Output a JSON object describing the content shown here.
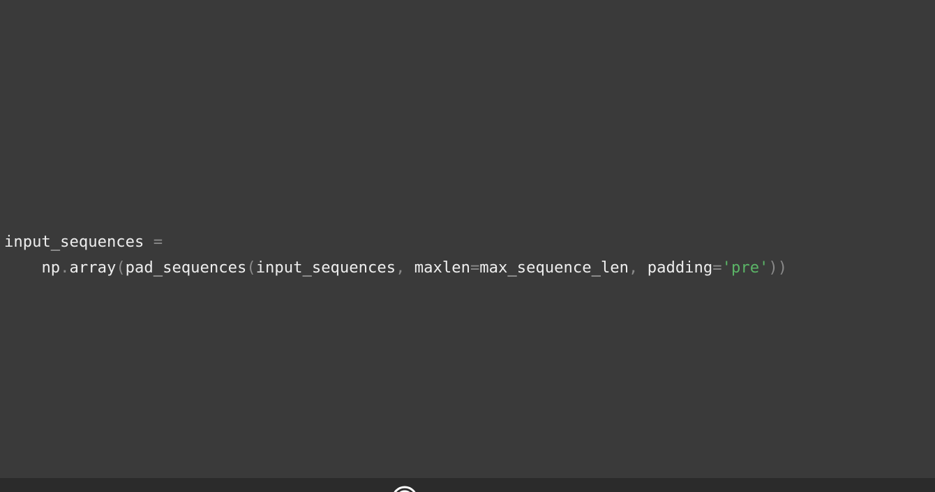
{
  "code": {
    "line1": [
      {
        "text": "input_sequences",
        "kind": "id"
      },
      {
        "text": " ",
        "kind": "id"
      },
      {
        "text": "=",
        "kind": "op"
      }
    ],
    "line2": [
      {
        "text": "    ",
        "kind": "id"
      },
      {
        "text": "np",
        "kind": "id"
      },
      {
        "text": ".",
        "kind": "punc"
      },
      {
        "text": "array",
        "kind": "id"
      },
      {
        "text": "(",
        "kind": "punc"
      },
      {
        "text": "pad_sequences",
        "kind": "id"
      },
      {
        "text": "(",
        "kind": "punc"
      },
      {
        "text": "input_sequences",
        "kind": "id"
      },
      {
        "text": ", ",
        "kind": "punc"
      },
      {
        "text": "maxlen",
        "kind": "id"
      },
      {
        "text": "=",
        "kind": "op"
      },
      {
        "text": "max_sequence_len",
        "kind": "id"
      },
      {
        "text": ", ",
        "kind": "punc"
      },
      {
        "text": "padding",
        "kind": "id"
      },
      {
        "text": "=",
        "kind": "op"
      },
      {
        "text": "'pre'",
        "kind": "str"
      },
      {
        "text": "))",
        "kind": "punc"
      }
    ]
  },
  "footer": {
    "logo_icon": "tensorflow-logo-icon"
  },
  "colors": {
    "background": "#3a3a3a",
    "footer": "#2b2b2b",
    "identifier": "#eeeeee",
    "punctuation": "#8a8a8a",
    "string": "#5bb567"
  }
}
